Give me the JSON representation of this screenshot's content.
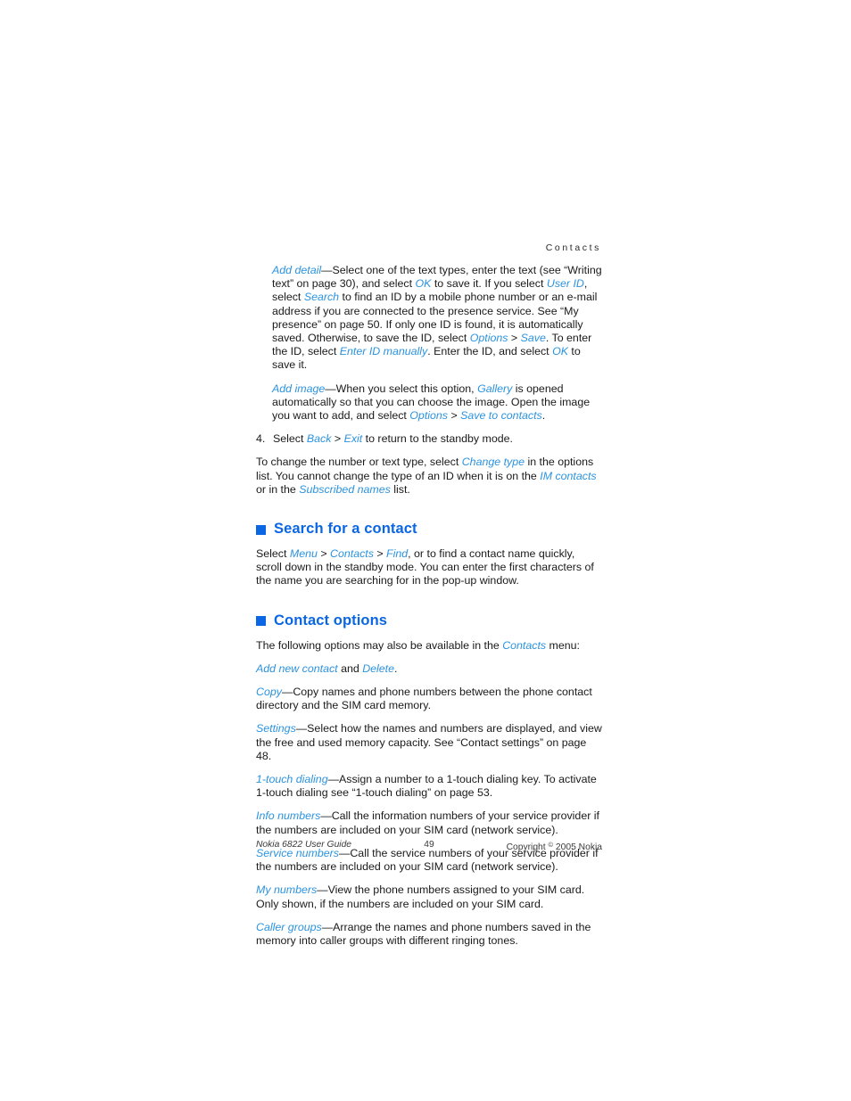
{
  "document": {
    "running_header": "Contacts",
    "page_number": "49"
  },
  "body": {
    "add_detail": {
      "term": "Add detail",
      "t1": "—Select one of the text types, enter the text (see “Writing text” on page 30), and select ",
      "ok1": "OK",
      "t2": " to save it. If you select ",
      "user_id": "User ID",
      "t3": ", select ",
      "search": "Search",
      "t4": " to find an ID by a mobile phone number or an e-mail address if you are connected to the presence service. See “My presence” on page 50. If only one ID is found, it is automatically saved. Otherwise, to save the ID, select ",
      "options": "Options",
      "gt1": " > ",
      "save": "Save",
      "t5": ". To enter the ID, select ",
      "enter_id_manually": "Enter ID manually",
      "t6": ". Enter the ID, and select ",
      "ok2": "OK",
      "t7": " to save it."
    },
    "add_image": {
      "term": "Add image",
      "t1": "—When you select this option, ",
      "gallery": "Gallery",
      "t2": " is opened automatically so that you can choose the image. Open the image you want to add, and select ",
      "options": "Options",
      "gt1": " > ",
      "save_to_contacts": "Save to contacts",
      "t3": "."
    },
    "step4": {
      "number": "4.",
      "t1": "Select ",
      "back": "Back",
      "gt1": " > ",
      "exit": "Exit",
      "t2": " to return to the standby mode."
    },
    "change_type": {
      "t1": "To change the number or text type, select ",
      "change_type": "Change type",
      "t2": " in the options list. You cannot change the type of an ID when it is on the ",
      "im_contacts": "IM contacts",
      "t3": " or in the ",
      "subscribed_names": "Subscribed names",
      "t4": " list."
    }
  },
  "search_section": {
    "heading": "Search for a contact",
    "p": {
      "t1": "Select ",
      "menu": "Menu",
      "gt1": " > ",
      "contacts": "Contacts",
      "gt2": " > ",
      "find": "Find",
      "t2": ", or to find a contact name quickly, scroll down in the standby mode. You can enter the first characters of the name you are searching for in the pop-up window."
    }
  },
  "contact_options_section": {
    "heading": "Contact options",
    "intro": {
      "t1": "The following options may also be available in the ",
      "contacts": "Contacts",
      "t2": " menu:"
    },
    "options": [
      {
        "term": "Add new contact",
        "t1": " and ",
        "term2": "Delete",
        "t2": "."
      },
      {
        "term": "Copy",
        "t1": "—Copy names and phone numbers between the phone contact directory and the SIM card memory."
      },
      {
        "term": "Settings",
        "t1": "—Select how the names and numbers are displayed, and view the free and used memory capacity. See “Contact settings” on page 48."
      },
      {
        "term": "1-touch dialing",
        "t1": "—Assign a number to a 1-touch dialing key. To activate 1-touch dialing see “1-touch dialing” on page 53."
      },
      {
        "term": "Info numbers",
        "t1": "—Call the information numbers of your service provider if the numbers are included on your SIM card (network service)."
      },
      {
        "term": "Service numbers",
        "t1": "—Call the service numbers of your service provider if the numbers are included on your SIM card (network service)."
      },
      {
        "term": "My numbers",
        "t1": "—View the phone numbers assigned to your SIM card. Only shown, if the numbers are included on your SIM card."
      },
      {
        "term": "Caller groups",
        "t1": "—Arrange the names and phone numbers saved in the memory into caller groups with different ringing tones."
      }
    ]
  },
  "footer": {
    "left": "Nokia 6822 User Guide",
    "center": "49",
    "right_pre": "Copyright ",
    "right_symbol": "©",
    "right_post": " 2005 Nokia"
  },
  "colors": {
    "heading_blue": "#0a66e3",
    "inline_blue": "#2b93e0",
    "text": "#1a1a1a"
  }
}
